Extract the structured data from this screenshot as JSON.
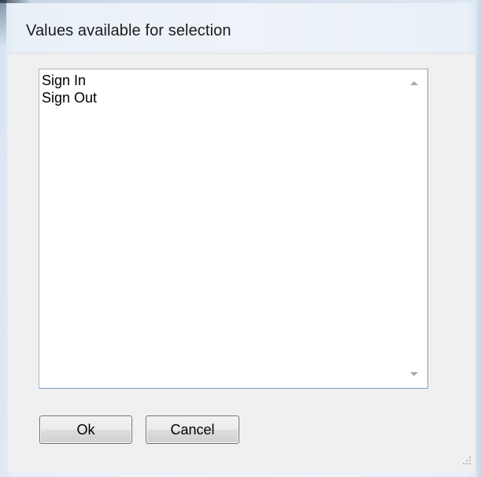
{
  "dialog": {
    "title": "Values available for selection"
  },
  "list": {
    "items": [
      "Sign In",
      "Sign Out"
    ]
  },
  "buttons": {
    "ok_label": "Ok",
    "cancel_label": "Cancel"
  },
  "icons": {
    "scroll_up": "chevron-up-icon",
    "scroll_down": "chevron-down-icon",
    "resize_grip": "resize-grip-icon"
  },
  "colors": {
    "window_frame": "#dfe9f3",
    "dialog_background": "#f0f0f0",
    "listbox_border": "#7a9cc0"
  }
}
